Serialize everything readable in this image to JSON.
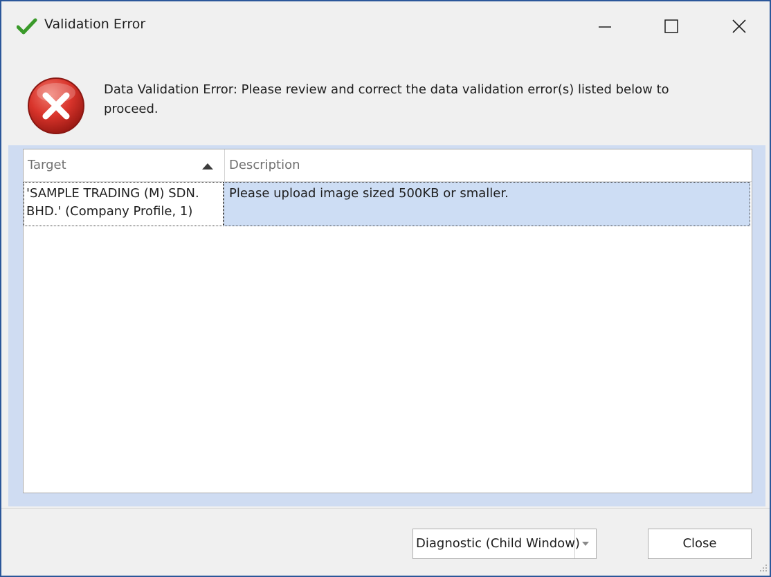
{
  "window": {
    "title": "Validation Error",
    "icon": "checkmark-icon",
    "controls": {
      "minimize": "minimize-icon",
      "maximize": "maximize-icon",
      "close": "close-icon"
    }
  },
  "message": {
    "icon": "error-icon",
    "text": "Data Validation Error: Please review and correct the data validation error(s) listed below to proceed."
  },
  "grid": {
    "columns": [
      "Target",
      "Description"
    ],
    "sort": {
      "column": "Target",
      "direction": "ascending"
    },
    "rows": [
      {
        "target": "'SAMPLE TRADING (M) SDN. BHD.' (Company Profile, 1)",
        "description": "Please upload image sized 500KB or smaller."
      }
    ]
  },
  "footer": {
    "mode_select": {
      "value": "Diagnostic (Child Window)"
    },
    "close_label": "Close"
  },
  "colors": {
    "accent_border": "#2b579a",
    "selection": "#cdddf4",
    "error_red": "#d9342b",
    "check_green": "#3a9a2a"
  }
}
